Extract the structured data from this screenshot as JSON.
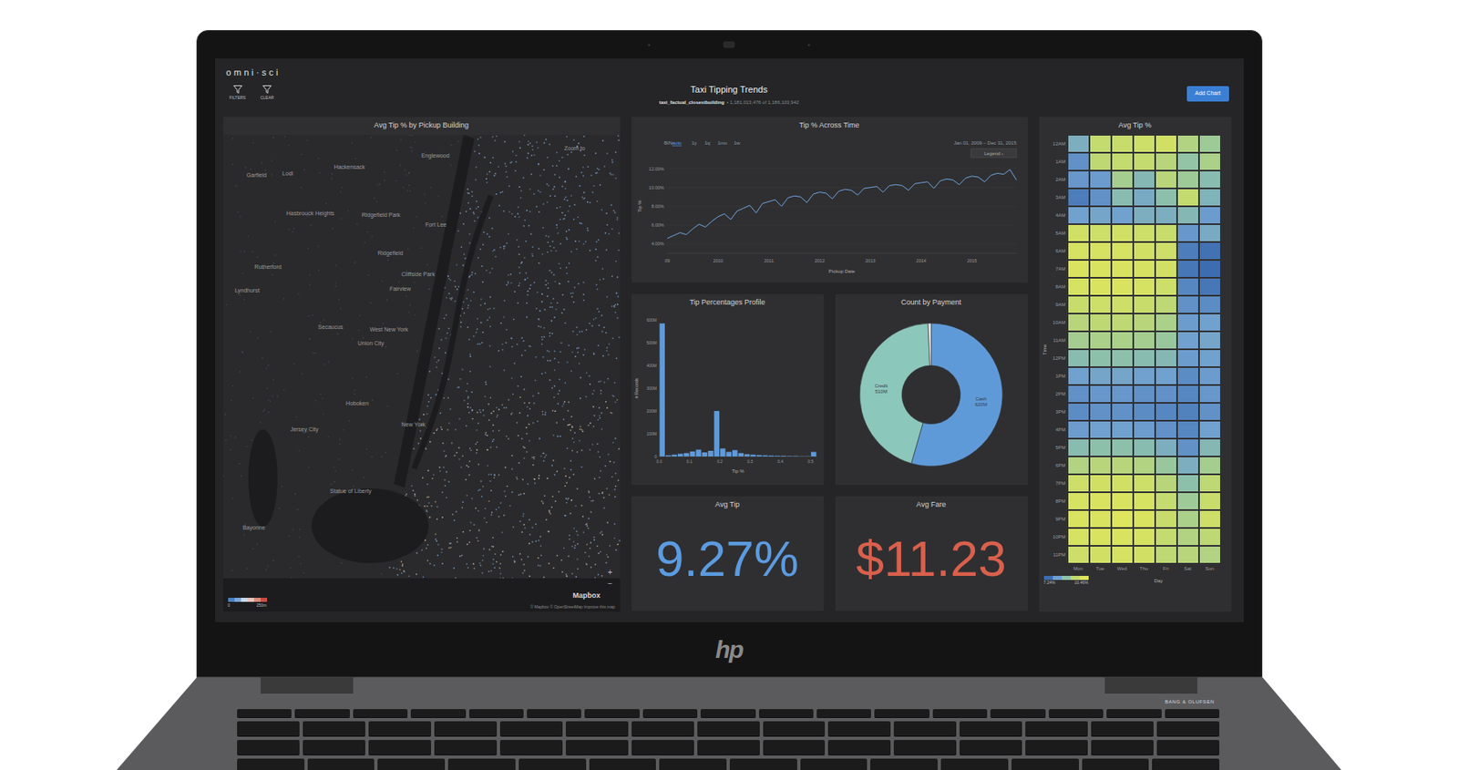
{
  "app": {
    "logo": "omni·sci",
    "title": "Taxi Tipping Trends",
    "subtitle_table": "taxi_factual_closestbuilding",
    "subtitle_count": "• 1,181,013,476 of 1,186,103,942",
    "toolbar": [
      {
        "label": "FILTERS"
      },
      {
        "label": "CLEAR"
      }
    ],
    "add_button": "Add Chart"
  },
  "map": {
    "title": "Avg Tip % by Pickup Building",
    "labels": [
      "Englewood",
      "Zoom to",
      "Garfield",
      "Lodi",
      "Hackensack",
      "Hasbrouck Heights",
      "Ridgefield Park",
      "Fort Lee",
      "Rutherford",
      "Ridgefield",
      "Cliffside Park",
      "Lyndhurst",
      "Fairview",
      "Secaucus",
      "West New York",
      "Union City",
      "Hoboken",
      "Jersey City",
      "New York",
      "Statue of Liberty",
      "Bayonne"
    ],
    "legend": [
      "0",
      "250m"
    ],
    "brand": "Mapbox",
    "attribution": "© Mapbox © OpenStreetMap Improve this map",
    "zoom": [
      "+",
      "−"
    ]
  },
  "line_chart": {
    "title": "Tip % Across Time",
    "bin_label": "BIN:",
    "bins": [
      {
        "label": "auto",
        "selected": true
      },
      {
        "label": "1y",
        "selected": false
      },
      {
        "label": "1q",
        "selected": false
      },
      {
        "label": "1mo",
        "selected": false
      },
      {
        "label": "1w",
        "selected": false
      }
    ],
    "range": "Jan 01, 2009 – Dec 31, 2015",
    "legend": "Legend ›",
    "y_label": "Tip %",
    "x_label": "Pickup Date",
    "y_ticks": [
      {
        "label": "12.00%",
        "value": 12
      },
      {
        "label": "10.00%",
        "value": 10
      },
      {
        "label": "8.00%",
        "value": 8
      },
      {
        "label": "6.00%",
        "value": 6
      },
      {
        "label": "4.00%",
        "value": 4
      }
    ],
    "x_ticks": [
      {
        "label": "09",
        "value": 0
      },
      {
        "label": "2010",
        "value": 8
      },
      {
        "label": "2011",
        "value": 16
      },
      {
        "label": "2012",
        "value": 24
      },
      {
        "label": "2013",
        "value": 32
      },
      {
        "label": "2014",
        "value": 40
      },
      {
        "label": "2015",
        "value": 48
      }
    ],
    "values": [
      4.6,
      4.9,
      5.2,
      5.0,
      5.6,
      6.1,
      5.8,
      6.4,
      6.9,
      7.2,
      6.6,
      7.5,
      7.8,
      8.1,
      7.3,
      8.3,
      8.5,
      8.7,
      8.0,
      8.9,
      9.1,
      9.0,
      8.4,
      9.3,
      9.5,
      9.4,
      8.8,
      9.6,
      9.8,
      9.7,
      9.2,
      9.9,
      10.0,
      10.1,
      9.5,
      10.2,
      10.3,
      10.2,
      9.7,
      10.4,
      10.5,
      10.6,
      9.9,
      10.7,
      10.9,
      10.8,
      10.3,
      11.0,
      11.2,
      11.1,
      10.6,
      11.3,
      11.5,
      11.4,
      11.9,
      10.8
    ]
  },
  "histogram": {
    "title": "Tip Percentages Profile",
    "y_label": "# Records",
    "x_label": "Tip %",
    "y_ticks": [
      {
        "label": "600M",
        "value": 600
      },
      {
        "label": "500M",
        "value": 500
      },
      {
        "label": "400M",
        "value": 400
      },
      {
        "label": "300M",
        "value": 300
      },
      {
        "label": "200M",
        "value": 200
      },
      {
        "label": "100M",
        "value": 100
      },
      {
        "label": "0",
        "value": 0
      }
    ],
    "x_ticks": [
      {
        "label": "0.0",
        "value": 0
      },
      {
        "label": "0.1",
        "value": 0.1
      },
      {
        "label": "0.2",
        "value": 0.2
      },
      {
        "label": "0.3",
        "value": 0.3
      },
      {
        "label": "0.4",
        "value": 0.4
      },
      {
        "label": "0.5",
        "value": 0.5
      }
    ],
    "values": [
      585,
      5,
      8,
      12,
      15,
      22,
      30,
      18,
      25,
      200,
      35,
      20,
      28,
      15,
      10,
      8,
      6,
      5,
      4,
      3,
      3,
      2,
      2,
      1,
      1,
      20
    ]
  },
  "donut": {
    "title": "Count by Payment",
    "slices": [
      {
        "label": "Cash",
        "reading": "620M",
        "value": 620,
        "color": "#5f9ad8"
      },
      {
        "label": "Credit",
        "reading": "510M",
        "value": 510,
        "color": "#8cc7bb"
      },
      {
        "label": "",
        "reading": "",
        "value": 8,
        "color": "#e8e8e8"
      }
    ]
  },
  "kpis": [
    {
      "title": "Avg Tip",
      "value": "9.27%",
      "color": "#5b9be0"
    },
    {
      "title": "Avg Fare",
      "value": "$11.23",
      "color": "#d9604c"
    }
  ],
  "heatmap": {
    "title": "Avg Tip %",
    "y_label": "Time",
    "x_label": "Day",
    "legend": [
      "7.24%",
      "10.46%"
    ],
    "rows": [
      "12AM",
      "1AM",
      "2AM",
      "3AM",
      "4AM",
      "5AM",
      "6AM",
      "7AM",
      "8AM",
      "9AM",
      "10AM",
      "11AM",
      "12PM",
      "1PM",
      "2PM",
      "3PM",
      "4PM",
      "5PM",
      "6PM",
      "7PM",
      "8PM",
      "9PM",
      "10PM",
      "11PM"
    ],
    "columns": [
      "Mon",
      "Tue",
      "Wed",
      "Thu",
      "Fri",
      "Sat",
      "Sun"
    ],
    "values": [
      [
        8.6,
        9.9,
        10.0,
        10.1,
        10.2,
        9.6,
        9.3
      ],
      [
        8.0,
        9.8,
        9.9,
        9.9,
        9.7,
        9.1,
        9.5
      ],
      [
        8.1,
        8.2,
        9.4,
        8.8,
        9.7,
        9.3,
        8.9
      ],
      [
        7.6,
        8.0,
        8.9,
        8.5,
        9.0,
        9.9,
        8.7
      ],
      [
        8.3,
        8.4,
        8.3,
        8.6,
        8.6,
        8.8,
        8.2
      ],
      [
        10.2,
        10.1,
        10.2,
        10.1,
        10.0,
        8.1,
        8.5
      ],
      [
        10.3,
        10.3,
        10.3,
        10.2,
        10.1,
        7.6,
        7.4
      ],
      [
        10.4,
        10.4,
        10.4,
        10.3,
        10.2,
        7.5,
        7.3
      ],
      [
        10.3,
        10.4,
        10.4,
        10.3,
        10.1,
        7.8,
        7.5
      ],
      [
        10.0,
        10.1,
        10.1,
        10.0,
        9.8,
        8.0,
        7.9
      ],
      [
        9.7,
        9.8,
        9.8,
        9.7,
        9.5,
        8.2,
        8.3
      ],
      [
        9.4,
        9.5,
        9.5,
        9.4,
        9.2,
        8.3,
        8.4
      ],
      [
        8.9,
        9.0,
        9.0,
        8.9,
        8.8,
        8.2,
        8.3
      ],
      [
        8.3,
        8.4,
        8.4,
        8.3,
        8.3,
        7.9,
        8.2
      ],
      [
        8.0,
        8.1,
        8.1,
        8.0,
        8.0,
        7.8,
        8.1
      ],
      [
        7.9,
        8.0,
        8.0,
        7.9,
        7.8,
        7.7,
        8.0
      ],
      [
        8.2,
        8.3,
        8.3,
        8.2,
        8.0,
        7.8,
        8.3
      ],
      [
        8.9,
        9.0,
        9.0,
        8.9,
        8.6,
        8.0,
        8.8
      ],
      [
        9.6,
        9.7,
        9.7,
        9.6,
        9.2,
        8.6,
        9.4
      ],
      [
        10.1,
        10.2,
        10.2,
        10.1,
        9.7,
        9.0,
        9.8
      ],
      [
        10.3,
        10.4,
        10.4,
        10.3,
        9.9,
        9.3,
        10.0
      ],
      [
        10.4,
        10.4,
        10.5,
        10.4,
        10.0,
        9.5,
        10.1
      ],
      [
        10.3,
        10.4,
        10.4,
        10.3,
        9.9,
        9.6,
        9.8
      ],
      [
        10.1,
        10.2,
        10.3,
        10.2,
        9.8,
        9.7,
        9.6
      ]
    ]
  },
  "laptop": {
    "logo": "hp",
    "speaker_brand": "BANG & OLUFSEN"
  }
}
